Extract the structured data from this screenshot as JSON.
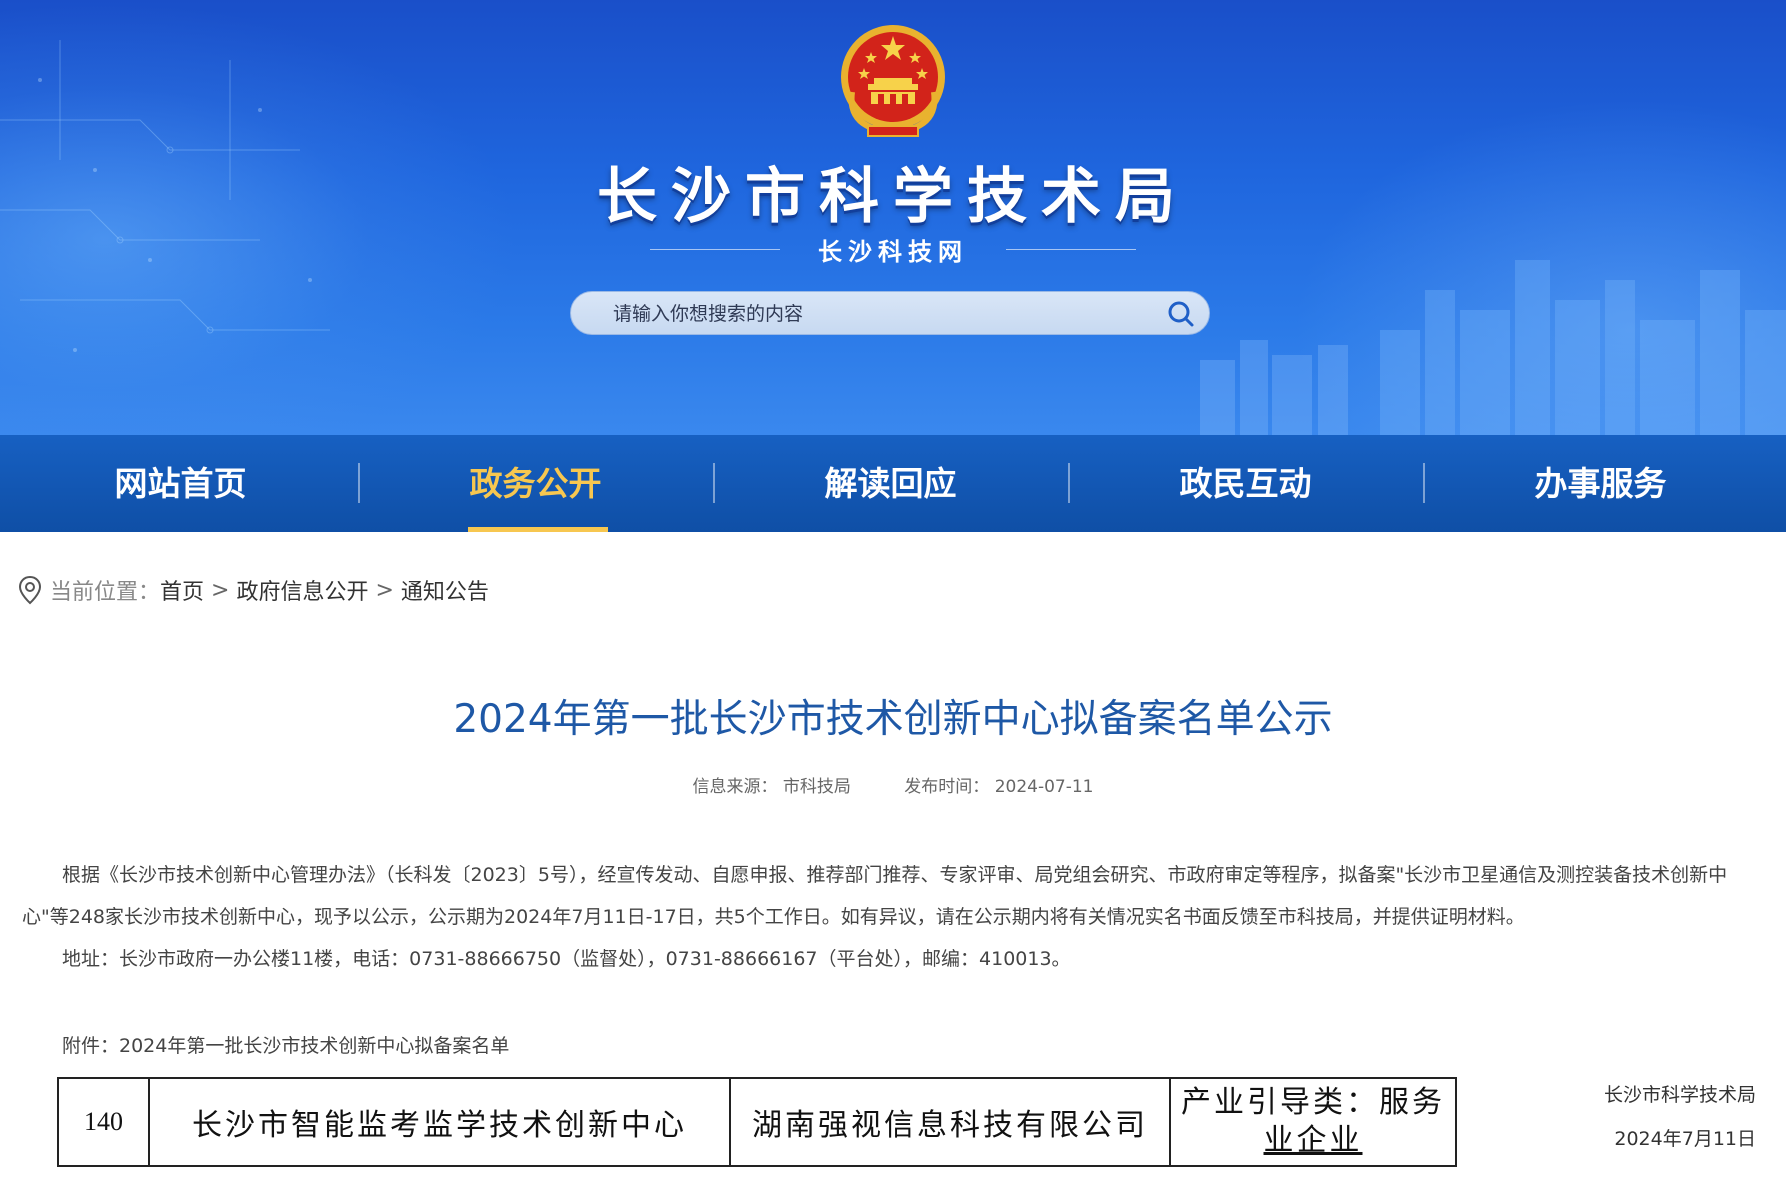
{
  "site": {
    "title": "长沙市科学技术局",
    "subtitle": "长沙科技网",
    "search_placeholder": "请输入你想搜索的内容",
    "search_icon": "search-icon"
  },
  "nav": {
    "items": [
      {
        "label": "网站首页"
      },
      {
        "label": "政务公开"
      },
      {
        "label": "解读回应"
      },
      {
        "label": "政民互动"
      },
      {
        "label": "办事服务"
      }
    ],
    "active_index": 1
  },
  "breadcrumb": {
    "prefix": "当前位置：",
    "items": [
      "首页",
      "政府信息公开",
      "通知公告"
    ],
    "separator": ">"
  },
  "article": {
    "title": "2024年第一批长沙市技术创新中心拟备案名单公示",
    "source": "信息来源： 市科技局",
    "published": "发布时间： 2024-07-11",
    "paragraph1": "根据《长沙市技术创新中心管理办法》（长科发〔2023〕5号），经宣传发动、自愿申报、推荐部门推荐、专家评审、局党组会研究、市政府审定等程序，拟备案\"长沙市卫星通信及测控装备技术创新中心\"等248家长沙市技术创新中心，现予以公示，公示期为2024年7月11日-17日，共5个工作日。如有异议，请在公示期内将有关情况实名书面反馈至市科技局，并提供证明材料。",
    "paragraph2": "地址：长沙市政府一办公楼11楼，电话：0731-88666750（监督处），0731-88666167（平台处），邮编：410013。",
    "attachment": "附件：2024年第一批长沙市技术创新中心拟备案名单",
    "sign_org": "长沙市科学技术局",
    "sign_date": "2024年7月11日"
  },
  "table": {
    "rows": [
      {
        "no": "140",
        "center": "长沙市智能监考监学技术创新中心",
        "company": "湖南强视信息科技有限公司",
        "category_line1": "产业引导类：服务",
        "category_line2": "业企业"
      }
    ]
  },
  "colors": {
    "banner": "#1f66de",
    "nav": "#1255b0",
    "nav_active": "#f7c750",
    "title": "#1e58a6"
  }
}
